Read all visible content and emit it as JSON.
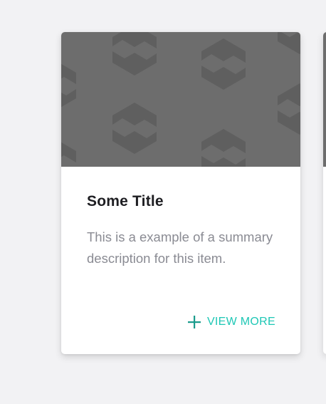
{
  "card": {
    "image": {
      "pattern": "s-logo-pattern",
      "background_color": "#6d6d6d",
      "pattern_color": "#5c5c5c"
    },
    "title": "Some Title",
    "description": "This is a example of a summary description for this item.",
    "action": {
      "icon": "plus-icon",
      "label": "VIEW MORE",
      "color": "#1ec7b5"
    }
  },
  "colors": {
    "page_background": "#f2f2f4",
    "card_background": "#ffffff",
    "title": "#1e1e22",
    "description": "#8a8b93",
    "accent": "#1ec7b5"
  }
}
